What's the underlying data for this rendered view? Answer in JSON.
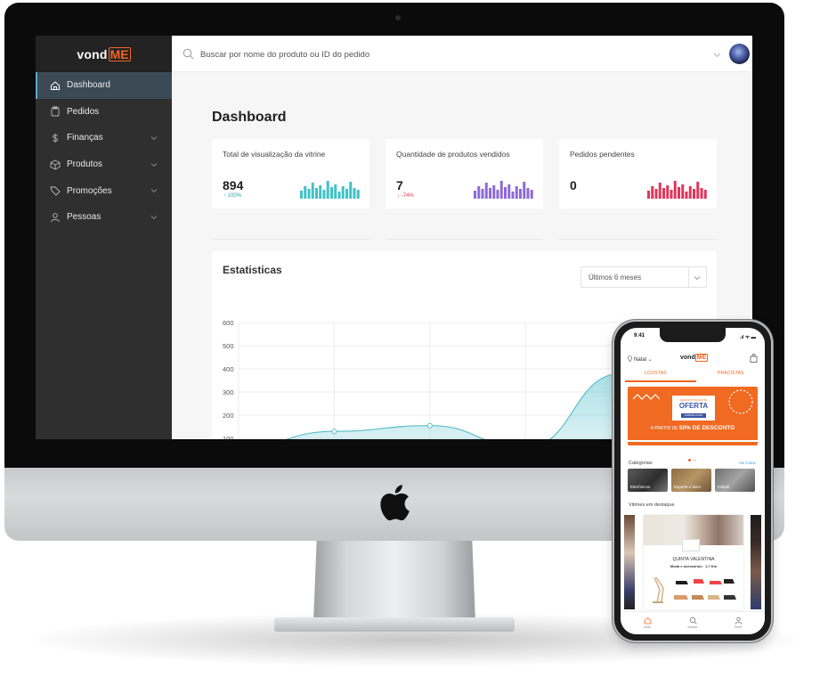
{
  "app": {
    "brand": "vond",
    "brand_accent": "ME",
    "accent_color": "#f26522"
  },
  "sidebar": {
    "items": [
      {
        "label": "Dashboard",
        "icon": "home-icon",
        "active": true
      },
      {
        "label": "Pedidos",
        "icon": "clipboard-icon"
      },
      {
        "label": "Finanças",
        "icon": "dollar-icon",
        "expandable": true
      },
      {
        "label": "Produtos",
        "icon": "box-icon",
        "expandable": true
      },
      {
        "label": "Promoções",
        "icon": "tag-icon",
        "expandable": true
      },
      {
        "label": "Pessoas",
        "icon": "user-icon",
        "expandable": true
      }
    ]
  },
  "topbar": {
    "search_placeholder": "Buscar por nome do produto ou ID do pedido"
  },
  "main": {
    "title": "Dashboard",
    "cards": [
      {
        "title": "Total de visualização da vitrine",
        "value": "894",
        "change": "↑ 100%",
        "change_color": "#1fa7a8",
        "bar_color": "#3fc2c9"
      },
      {
        "title": "Quantidade de produtos vendidos",
        "value": "7",
        "change": "↓ -74%",
        "change_color": "#e0365a",
        "bar_color": "#8e6ad6"
      },
      {
        "title": "Pedidos pendentes",
        "value": "0",
        "change": "",
        "change_color": "#e0365a",
        "bar_color": "#e0365a"
      }
    ],
    "stats": {
      "title": "Estatisticas",
      "period": "Últimos 6 meses"
    }
  },
  "chart_data": {
    "type": "area",
    "y_ticks": [
      "600",
      "500",
      "400",
      "300",
      "200",
      "100"
    ],
    "ylim": [
      0,
      600
    ],
    "series_color": "#7fd0da",
    "points": [
      [
        0,
        60
      ],
      [
        1,
        130
      ],
      [
        2,
        155
      ],
      [
        3,
        60
      ],
      [
        4,
        380
      ],
      [
        5,
        560
      ]
    ]
  },
  "phone": {
    "time": "9:41",
    "status": ".ıl ᯤ ▬",
    "location": "Natal",
    "brand": "vond",
    "brand_accent": "ME",
    "tabs": [
      "LOJISTAS",
      "PRACISTAS"
    ],
    "banner": {
      "small": "DESCONTOS DE ATÉ",
      "offer": "OFERTA",
      "button": "COMPRE AGORA",
      "foot_prefix": "A PARTIR DE ",
      "foot_bold": "50% DE DESCONTO"
    },
    "categories_title": "Categorias",
    "see_all": "Ver todas",
    "categories": [
      "Eletrônicos",
      "Esporte e lazer",
      "Infantil"
    ],
    "showcase_title": "Vitrines em destaque",
    "store_name": "QUINTA VALENTINA",
    "store_meta": "Moda e acessórios · 1,7 Km",
    "bottom_nav": [
      "Início",
      "Buscar",
      "Perfil"
    ]
  }
}
